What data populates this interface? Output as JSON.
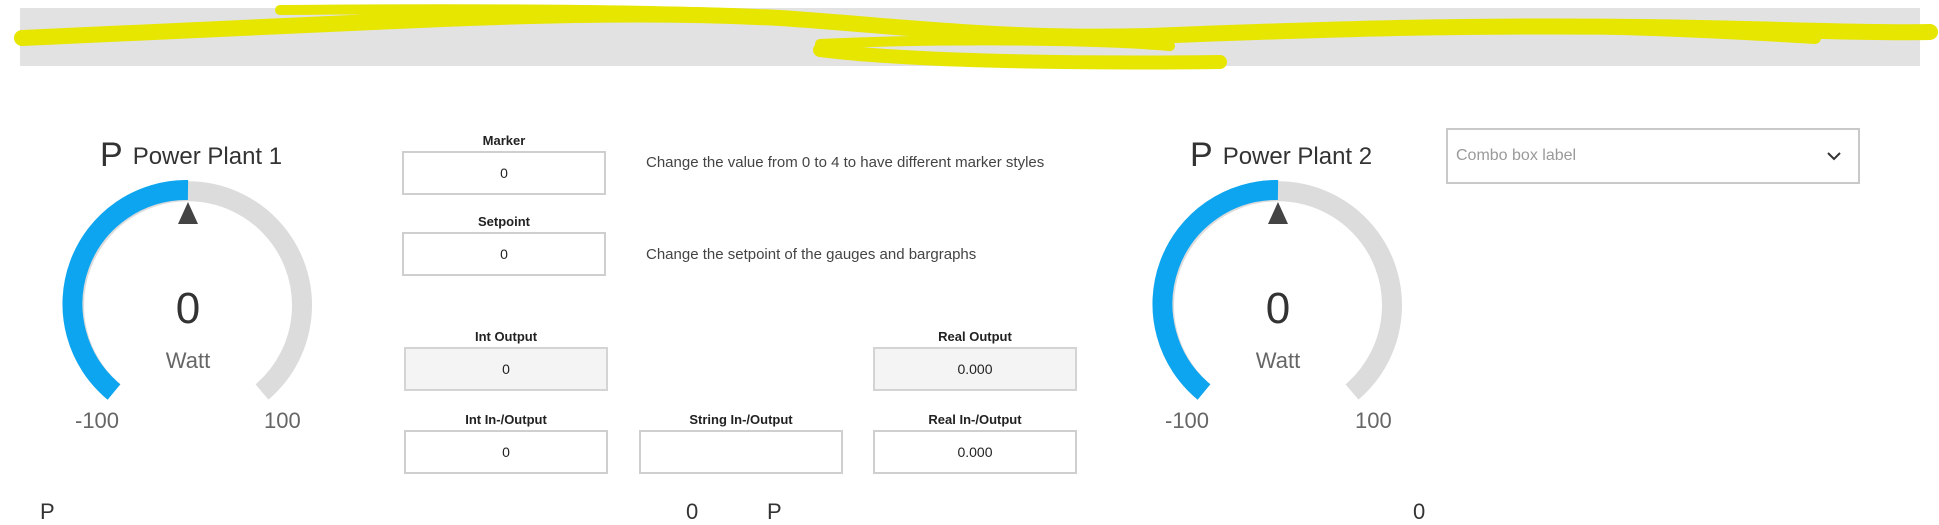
{
  "colors": {
    "gauge_active": "#0ea5f0",
    "gauge_track": "#dcdcdc",
    "marker": "#444444",
    "highlight_scribble": "#e6e600",
    "topbar_bg": "#e2e2e2"
  },
  "gauges": [
    {
      "icon": "P",
      "title": "Power Plant 1",
      "value": "0",
      "unit": "Watt",
      "min": "-100",
      "max": "100"
    },
    {
      "icon": "P",
      "title": "Power Plant 2",
      "value": "0",
      "unit": "Watt",
      "min": "-100",
      "max": "100"
    }
  ],
  "controls": {
    "marker": {
      "label": "Marker",
      "value": "0",
      "note": "Change the value from 0 to 4 to have different marker styles"
    },
    "setpoint": {
      "label": "Setpoint",
      "value": "0",
      "note": "Change the setpoint of the gauges and bargraphs"
    },
    "int_output": {
      "label": "Int Output",
      "value": "0"
    },
    "real_output": {
      "label": "Real Output",
      "value": "0.000"
    },
    "int_inout": {
      "label": "Int In-/Output",
      "value": "0"
    },
    "string_inout": {
      "label": "String In-/Output",
      "value": ""
    },
    "real_inout": {
      "label": "Real In-/Output",
      "value": "0.000"
    }
  },
  "combo": {
    "placeholder": "Combo box label",
    "icon": "chevron-down-icon"
  },
  "bottom": {
    "left_icon": "P",
    "left_value": "0",
    "right_icon": "P",
    "right_value": "0"
  }
}
